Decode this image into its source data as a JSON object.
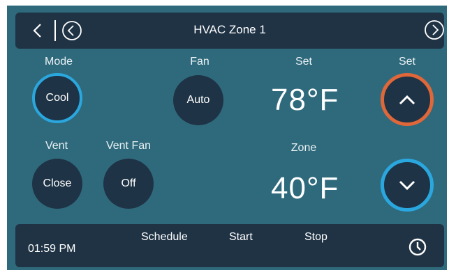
{
  "header": {
    "title": "HVAC Zone 1",
    "icons": [
      "back-chevron-icon",
      "prev-circle-icon",
      "next-circle-icon"
    ]
  },
  "mode": {
    "label": "Mode",
    "value": "Cool"
  },
  "fan": {
    "label": "Fan",
    "value": "Auto"
  },
  "vent": {
    "label": "Vent",
    "value": "Close"
  },
  "vent_fan": {
    "label": "Vent Fan",
    "value": "Off"
  },
  "setpoint": {
    "label": "Set",
    "value": "78°F"
  },
  "setpoint_control": {
    "label": "Set"
  },
  "zone": {
    "label": "Zone",
    "value": "40°F"
  },
  "footer": {
    "time": "01:59 PM",
    "schedule_label": "Schedule",
    "start_label": "Start",
    "stop_label": "Stop"
  },
  "colors": {
    "background": "#2f6a7c",
    "bar": "#1f3345",
    "button": "#1e3345",
    "accent_blue": "#2aa7df",
    "accent_orange": "#e0673a"
  }
}
